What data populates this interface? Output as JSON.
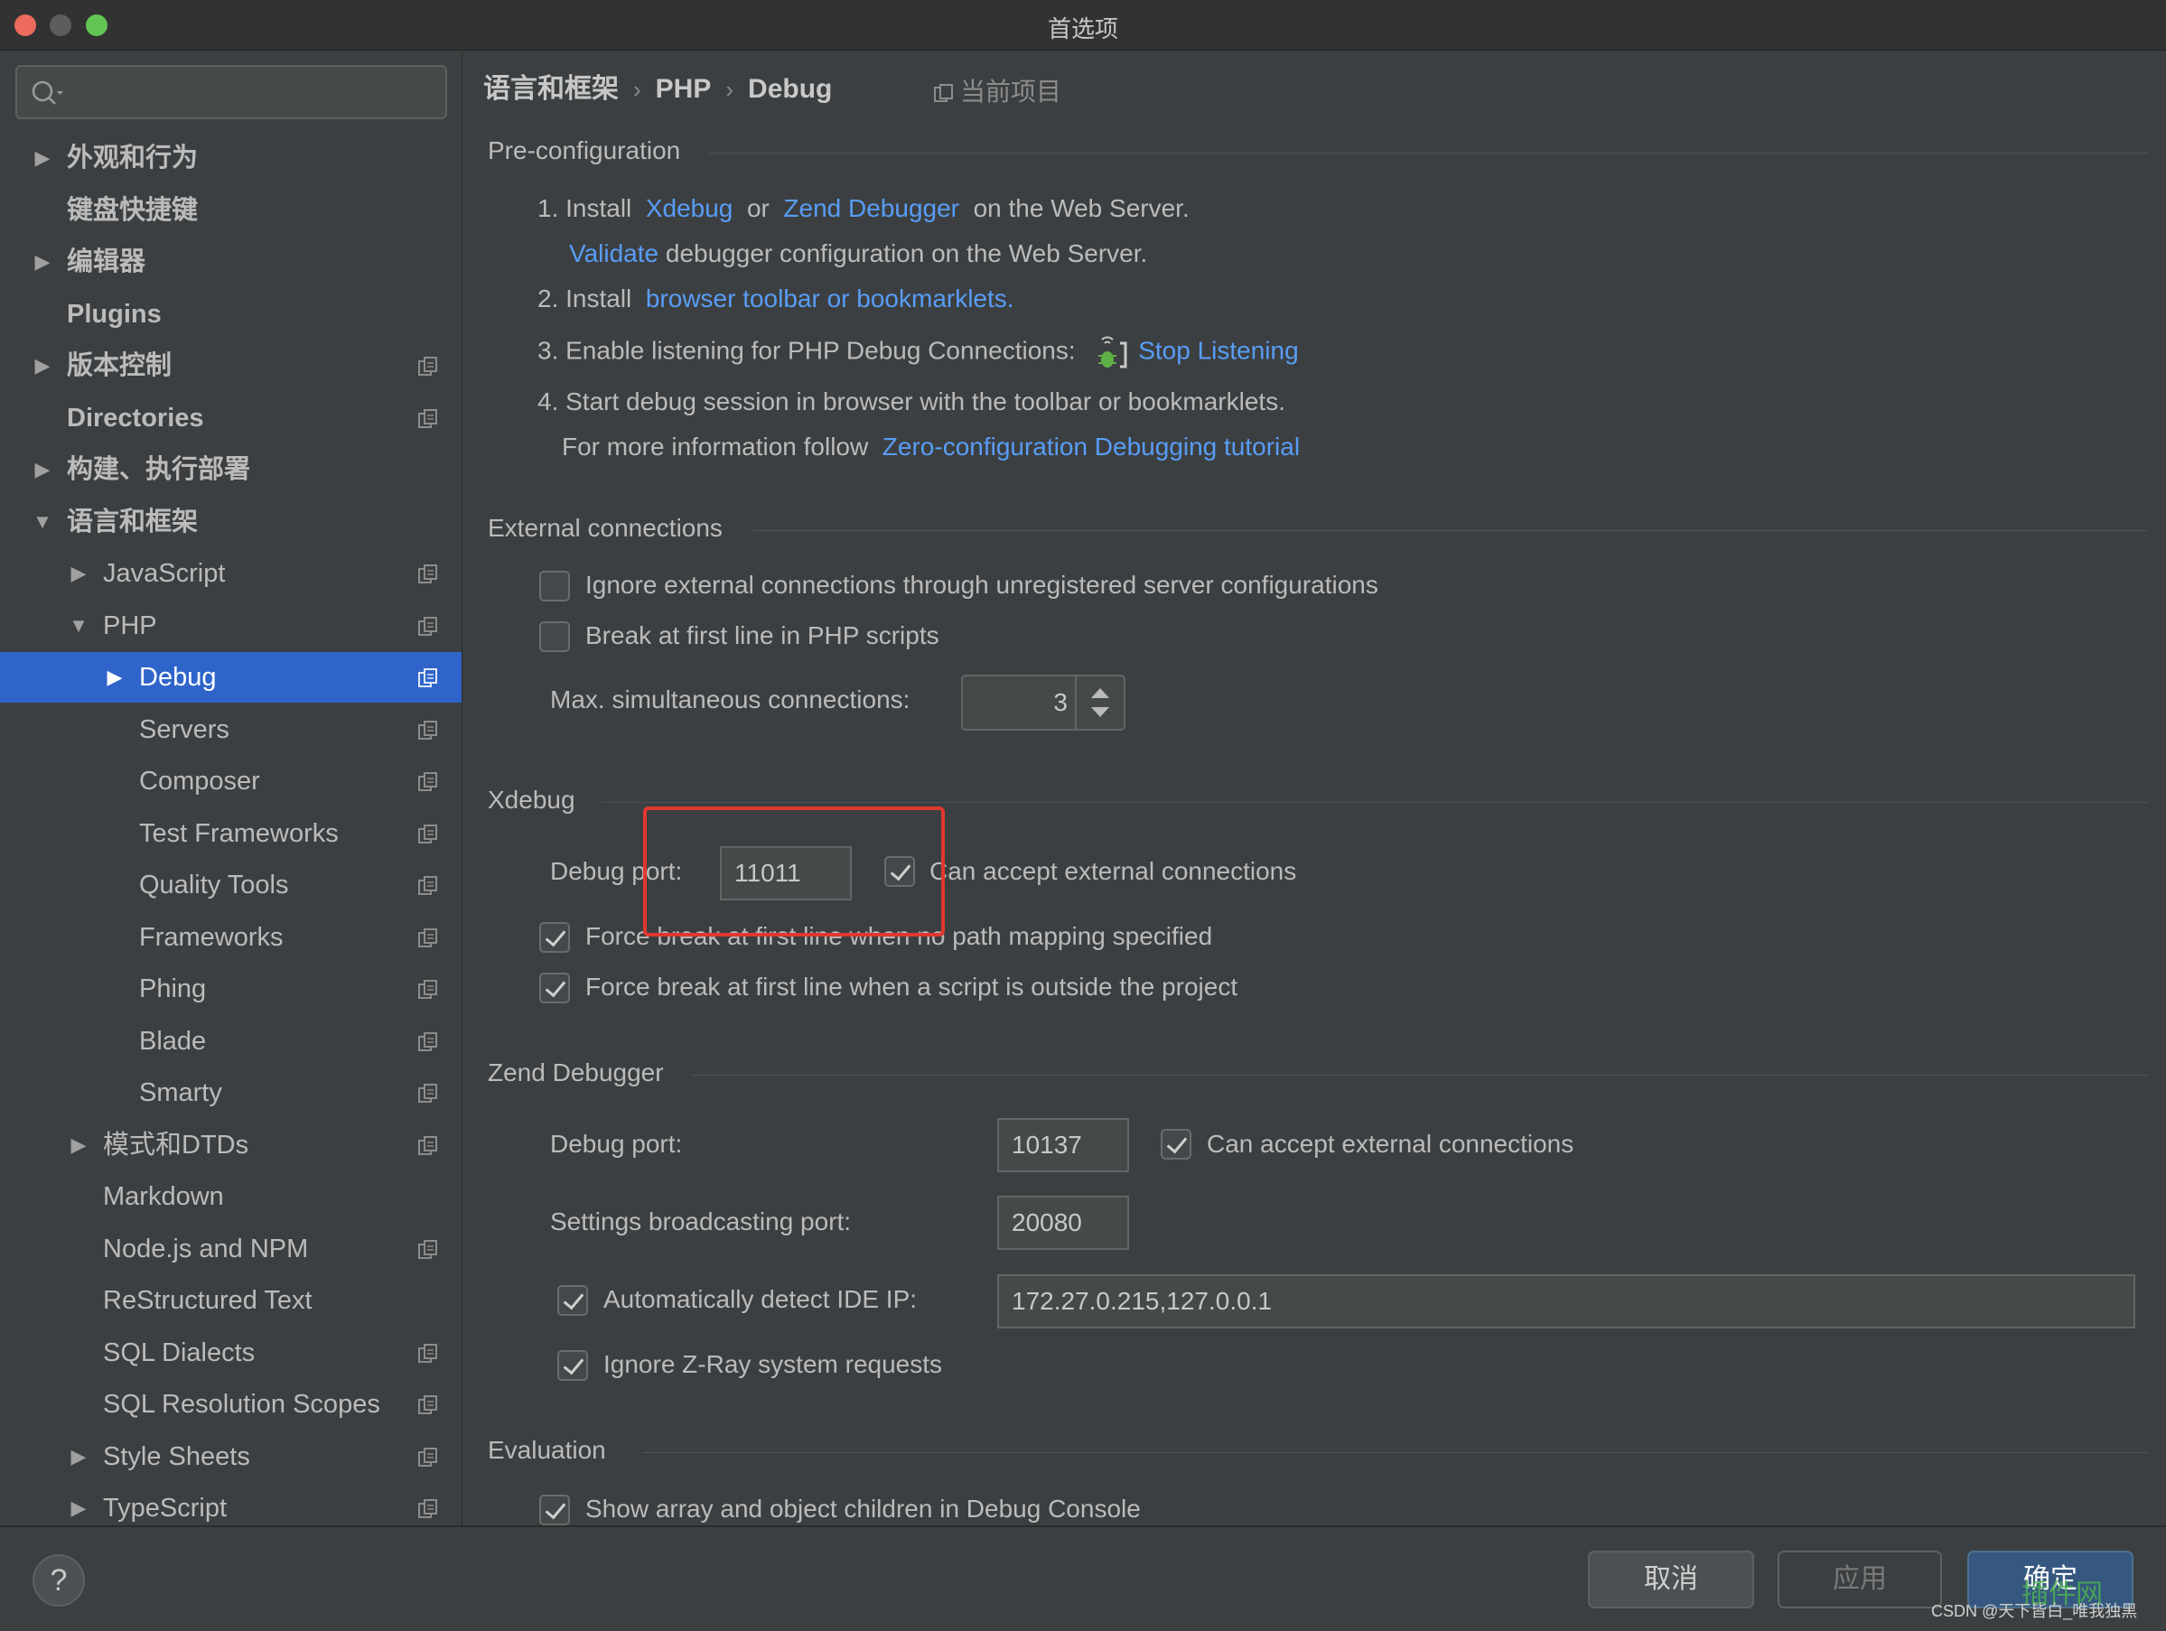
{
  "window": {
    "title": "首选项"
  },
  "sidebar": {
    "search_placeholder": "",
    "items": [
      {
        "label": "外观和行为",
        "arrow": "▶"
      },
      {
        "label": "键盘快捷键",
        "arrow": ""
      },
      {
        "label": "编辑器",
        "arrow": "▶"
      },
      {
        "label": "Plugins",
        "arrow": ""
      },
      {
        "label": "版本控制",
        "arrow": "▶"
      },
      {
        "label": "Directories",
        "arrow": ""
      },
      {
        "label": "构建、执行部署",
        "arrow": "▶"
      },
      {
        "label": "语言和框架",
        "arrow": "▼"
      },
      {
        "label": "JavaScript",
        "arrow": "▶"
      },
      {
        "label": "PHP",
        "arrow": "▼"
      },
      {
        "label": "Debug",
        "arrow": "▶"
      },
      {
        "label": "Servers",
        "arrow": ""
      },
      {
        "label": "Composer",
        "arrow": ""
      },
      {
        "label": "Test Frameworks",
        "arrow": ""
      },
      {
        "label": "Quality Tools",
        "arrow": ""
      },
      {
        "label": "Frameworks",
        "arrow": ""
      },
      {
        "label": "Phing",
        "arrow": ""
      },
      {
        "label": "Blade",
        "arrow": ""
      },
      {
        "label": "Smarty",
        "arrow": ""
      },
      {
        "label": "模式和DTDs",
        "arrow": "▶"
      },
      {
        "label": "Markdown",
        "arrow": ""
      },
      {
        "label": "Node.js and NPM",
        "arrow": ""
      },
      {
        "label": "ReStructured Text",
        "arrow": ""
      },
      {
        "label": "SQL Dialects",
        "arrow": ""
      },
      {
        "label": "SQL Resolution Scopes",
        "arrow": ""
      },
      {
        "label": "Style Sheets",
        "arrow": "▶"
      },
      {
        "label": "TypeScript",
        "arrow": "▶"
      }
    ]
  },
  "breadcrumb": {
    "part1": "语言和框架",
    "part2": "PHP",
    "part3": "Debug",
    "sep": "›"
  },
  "current_project": "当前项目",
  "preconfig": {
    "title": "Pre-configuration",
    "step1_prefix": "1. Install",
    "xdebug_link": "Xdebug",
    "or": "or",
    "zend_link": "Zend Debugger",
    "step1_suffix": "on the Web Server.",
    "validate_link": "Validate",
    "validate_suffix": "debugger configuration on the Web Server.",
    "step2_prefix": "2. Install",
    "toolbar_link": "browser toolbar or bookmarklets.",
    "step3": "3. Enable listening for PHP Debug Connections:",
    "stop_listening_link": "Stop Listening",
    "step4": "4. Start debug session in browser with the toolbar or bookmarklets.",
    "more_info": "For more information follow",
    "tutorial_link": "Zero-configuration Debugging tutorial"
  },
  "external": {
    "title": "External connections",
    "ignore_label": "Ignore external connections through unregistered server configurations",
    "ignore_checked": false,
    "break_label": "Break at first line in PHP scripts",
    "break_checked": false,
    "max_label": "Max. simultaneous connections:",
    "max_value": "3"
  },
  "xdebug": {
    "title": "Xdebug",
    "port_label": "Debug port:",
    "port_value": "11011",
    "accept_label": "Can accept external connections",
    "accept_checked": true,
    "force1_label": "Force break at first line when no path mapping specified",
    "force2_label": "Force break at first line when a script is outside the project"
  },
  "zend": {
    "title": "Zend Debugger",
    "port_label": "Debug port:",
    "port_value": "10137",
    "accept_label": "Can accept external connections",
    "broadcast_label": "Settings broadcasting port:",
    "broadcast_value": "20080",
    "detect_label": "Automatically detect IDE IP:",
    "detect_value": "172.27.0.215,127.0.0.1",
    "zray_label": "Ignore Z-Ray system requests"
  },
  "evaluation": {
    "title": "Evaluation",
    "show_array_label": "Show array and object children in Debug Console"
  },
  "footer": {
    "help": "?",
    "cancel": "取消",
    "apply": "应用",
    "ok": "确定"
  },
  "watermark": {
    "site": "插件网",
    "credit": "CSDN @天下皆白_唯我独黑"
  }
}
